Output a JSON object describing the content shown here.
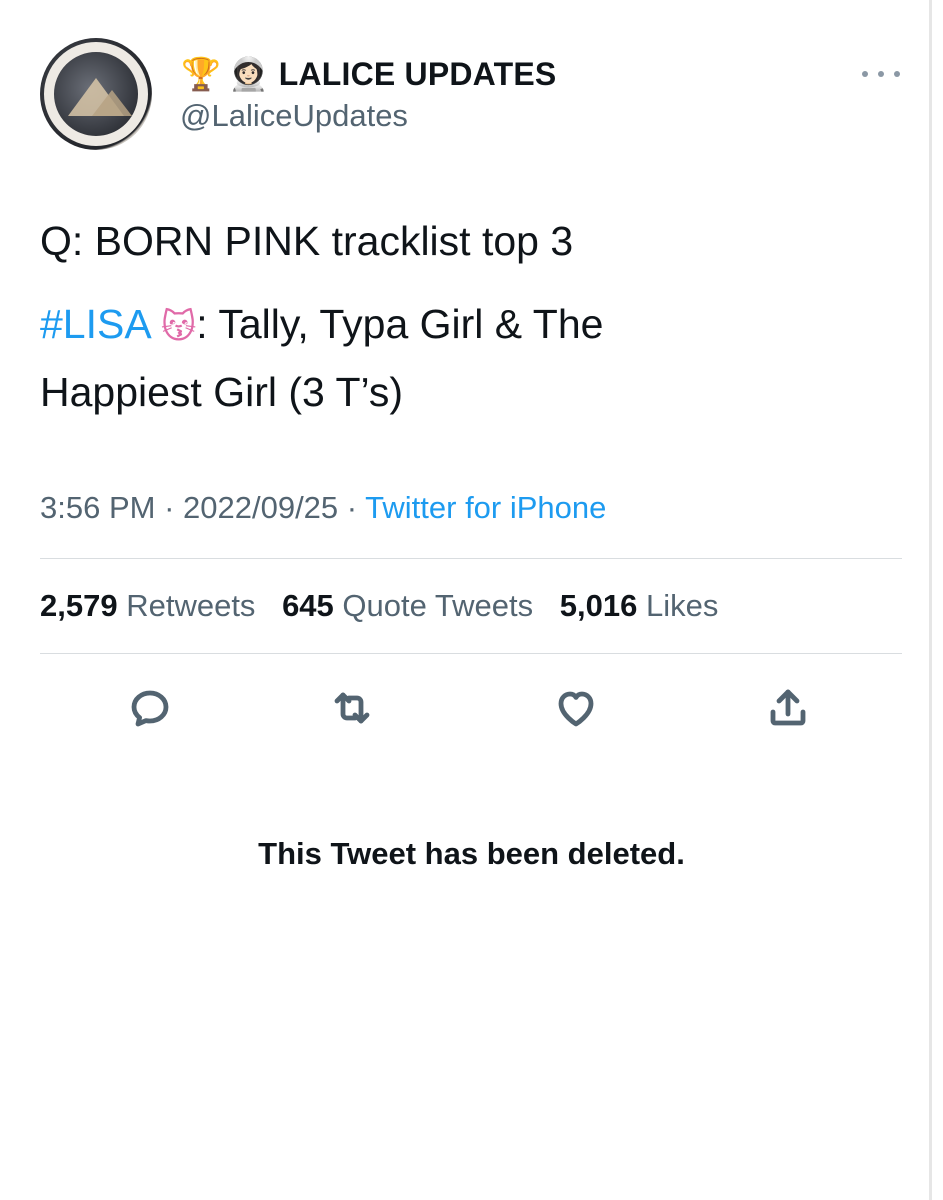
{
  "author": {
    "emojis": [
      "🏆",
      "👩🏻‍🚀"
    ],
    "display_name": "LALICE UPDATES",
    "handle": "@LaliceUpdates"
  },
  "tweet": {
    "line1": "Q: BORN PINK tracklist top 3",
    "hashtag": "#LISA",
    "cat_emoji": "😽",
    "line2_rest": ": Tally, Typa Girl & The",
    "line3": "Happiest Girl (3 T’s)"
  },
  "meta": {
    "time": "3:56 PM",
    "separator": " · ",
    "date": "2022/09/25",
    "source": "Twitter for iPhone"
  },
  "stats": {
    "retweets_count": "2,579",
    "retweets_label": "Retweets",
    "quotes_count": "645",
    "quotes_label": "Quote Tweets",
    "likes_count": "5,016",
    "likes_label": "Likes"
  },
  "actions": {
    "reply": "reply-icon",
    "retweet": "retweet-icon",
    "like": "heart-icon",
    "share": "share-icon"
  },
  "notice": "This Tweet has been deleted.",
  "colors": {
    "link": "#1d9bf0",
    "secondary": "#536471",
    "text": "#0f1419"
  }
}
